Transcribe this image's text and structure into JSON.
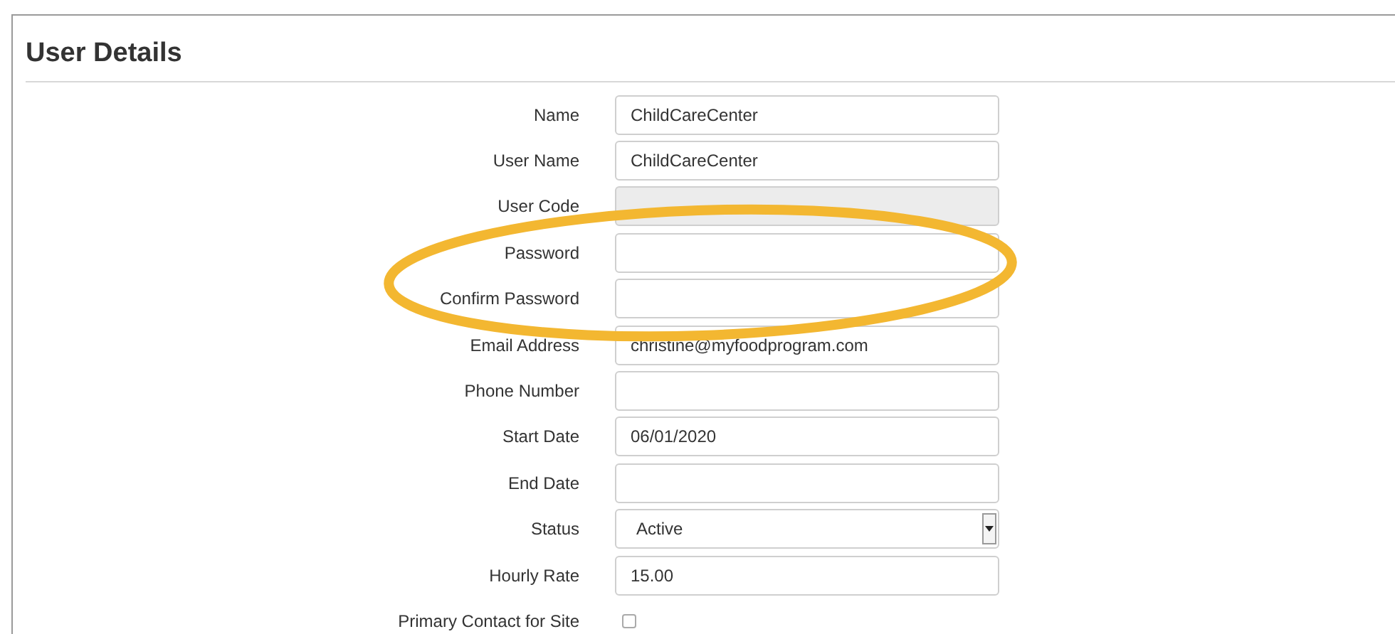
{
  "title": "User Details",
  "fields": [
    {
      "kind": "text",
      "label": "Name",
      "value": "ChildCareCenter",
      "disabled": false
    },
    {
      "kind": "text",
      "label": "User Name",
      "value": "ChildCareCenter",
      "disabled": false
    },
    {
      "kind": "text",
      "label": "User Code",
      "disabled": true
    },
    {
      "kind": "text",
      "label": "Password",
      "disabled": false
    },
    {
      "kind": "text",
      "label": "Confirm Password",
      "disabled": false
    },
    {
      "kind": "text",
      "label": "Email Address",
      "value": "christine@myfoodprogram.com",
      "disabled": false
    },
    {
      "kind": "text",
      "label": "Phone Number",
      "disabled": false
    },
    {
      "kind": "text",
      "label": "Start Date",
      "value": "06/01/2020",
      "disabled": false
    },
    {
      "kind": "text",
      "label": "End Date",
      "disabled": false
    },
    {
      "kind": "select",
      "label": "Status",
      "value": "Active"
    },
    {
      "kind": "text",
      "label": "Hourly Rate",
      "value": "15.00",
      "disabled": false
    },
    {
      "kind": "checkbox",
      "label": "Primary Contact for Site",
      "checked": false
    }
  ]
}
